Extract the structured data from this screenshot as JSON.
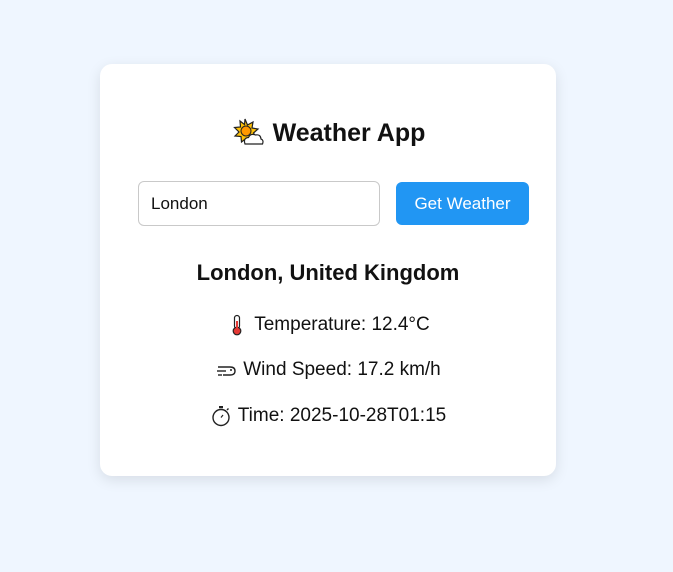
{
  "app": {
    "title": "Weather App",
    "title_icon": "sun-behind-cloud-icon"
  },
  "search": {
    "value": "London",
    "button_label": "Get Weather"
  },
  "result": {
    "location": "London, United Kingdom",
    "temperature_label": "Temperature: 12.4°C",
    "wind_label": "Wind Speed: 17.2 km/h",
    "time_label": "Time: 2025-10-28T01:15"
  },
  "colors": {
    "background": "#eff6ff",
    "card": "#ffffff",
    "accent": "#2196f3"
  }
}
